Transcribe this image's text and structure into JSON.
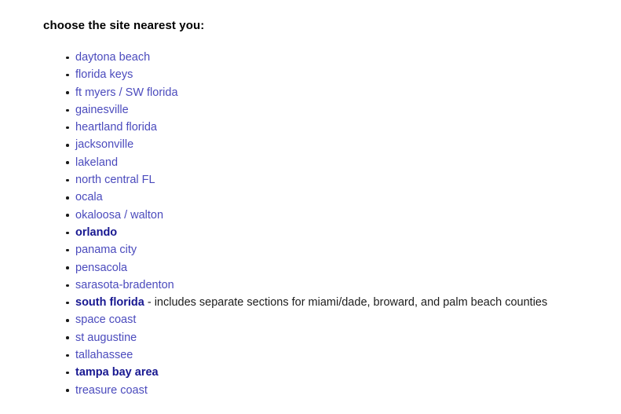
{
  "page": {
    "heading": "choose the site nearest you:",
    "background_color": "#ffffff",
    "link_color": "#4b4bbd",
    "featured_link_color": "#181891",
    "text_color": "#1c1c1c",
    "bullet_color": "#1a1a1a"
  },
  "sites": [
    {
      "label": "daytona beach",
      "featured": false,
      "suffix": ""
    },
    {
      "label": "florida keys",
      "featured": false,
      "suffix": ""
    },
    {
      "label": "ft myers / SW florida",
      "featured": false,
      "suffix": ""
    },
    {
      "label": "gainesville",
      "featured": false,
      "suffix": ""
    },
    {
      "label": "heartland florida",
      "featured": false,
      "suffix": ""
    },
    {
      "label": "jacksonville",
      "featured": false,
      "suffix": ""
    },
    {
      "label": "lakeland",
      "featured": false,
      "suffix": ""
    },
    {
      "label": "north central FL",
      "featured": false,
      "suffix": ""
    },
    {
      "label": "ocala",
      "featured": false,
      "suffix": ""
    },
    {
      "label": "okaloosa / walton",
      "featured": false,
      "suffix": ""
    },
    {
      "label": "orlando",
      "featured": true,
      "suffix": ""
    },
    {
      "label": "panama city",
      "featured": false,
      "suffix": ""
    },
    {
      "label": "pensacola",
      "featured": false,
      "suffix": ""
    },
    {
      "label": "sarasota-bradenton",
      "featured": false,
      "suffix": ""
    },
    {
      "label": "south florida",
      "featured": true,
      "suffix": " - includes separate sections for miami/dade, broward, and palm beach counties"
    },
    {
      "label": "space coast",
      "featured": false,
      "suffix": ""
    },
    {
      "label": "st augustine",
      "featured": false,
      "suffix": ""
    },
    {
      "label": "tallahassee",
      "featured": false,
      "suffix": ""
    },
    {
      "label": "tampa bay area",
      "featured": true,
      "suffix": ""
    },
    {
      "label": "treasure coast",
      "featured": false,
      "suffix": ""
    }
  ]
}
